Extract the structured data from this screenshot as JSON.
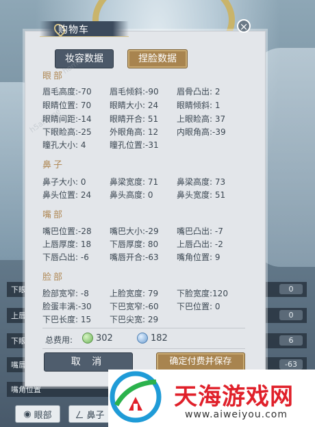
{
  "dialog": {
    "title": "购物车",
    "close_symbol": "×",
    "tabs": {
      "makeup": "妆容数据",
      "face": "捏脸数据"
    }
  },
  "sections": [
    {
      "title": "眼部",
      "rows": [
        [
          "眉毛高度:-70",
          "眉毛倾斜:-90",
          "眉骨凸出: 2"
        ],
        [
          "眼睛位置: 70",
          "眼睛大小: 24",
          "眼睛倾斜: 1"
        ],
        [
          "眼睛间距:-14",
          "眼睛开合: 51",
          "上眼睑高: 37"
        ],
        [
          "下眼睑高:-25",
          "外眼角高: 12",
          "内眼角高:-39"
        ],
        [
          "瞳孔大小: 4",
          "瞳孔位置:-31",
          ""
        ]
      ]
    },
    {
      "title": "鼻子",
      "rows": [
        [
          "鼻子大小: 0",
          "鼻梁宽度: 71",
          "鼻梁高度: 73"
        ],
        [
          "鼻头位置: 24",
          "鼻头高度: 0",
          "鼻头宽度: 51"
        ]
      ]
    },
    {
      "title": "嘴部",
      "rows": [
        [
          "嘴巴位置:-28",
          "嘴巴大小:-29",
          "嘴巴凸出: -7"
        ],
        [
          "上唇厚度: 18",
          "下唇厚度: 80",
          "上唇凸出: -2"
        ],
        [
          "下唇凸出: -6",
          "嘴唇开合:-63",
          "嘴角位置: 9"
        ]
      ]
    },
    {
      "title": "脸部",
      "rows": [
        [
          "脸部宽窄: -8",
          "上脸宽度: 79",
          "下脸宽度:120"
        ],
        [
          "脸蛋丰满:-30",
          "下巴宽窄:-60",
          "下巴位置: 0"
        ],
        [
          "下巴长度: 15",
          "下巴尖宽: 29",
          ""
        ]
      ]
    }
  ],
  "cost": {
    "label": "总费用:",
    "green_amount": "302",
    "blue_amount": "182"
  },
  "buttons": {
    "cancel": "取 消",
    "confirm": "确定付费并保存"
  },
  "background": {
    "slider_rows": [
      {
        "label": "下眼",
        "value": "0"
      },
      {
        "label": "上唇",
        "value": "0"
      },
      {
        "label": "下眼",
        "value": "6"
      },
      {
        "label": "嘴唇",
        "value": "-63"
      }
    ],
    "mouth_corner_label": "嘴角位置",
    "bottom_tabs": [
      "眼部",
      "鼻子"
    ]
  },
  "watermark": {
    "brand": "天海游戏网",
    "url": "www.aiweiyou.com"
  },
  "colors": {
    "accent_gold": "#a8844f",
    "dark_slate": "#4b5868",
    "section_title": "#b08a58",
    "brand_red": "#e0202a"
  }
}
